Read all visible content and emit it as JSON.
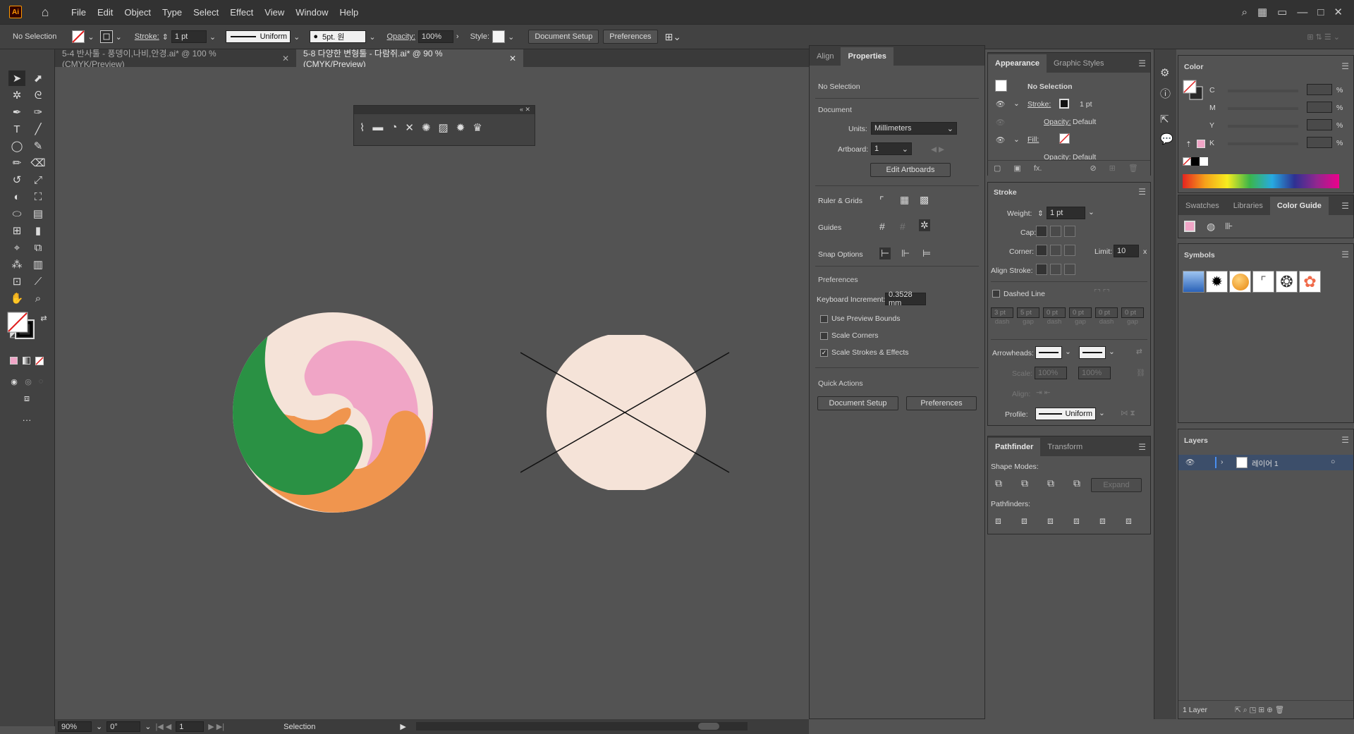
{
  "menubar": {
    "logo": "Ai",
    "menus": [
      "File",
      "Edit",
      "Object",
      "Type",
      "Select",
      "Effect",
      "View",
      "Window",
      "Help"
    ]
  },
  "control": {
    "selection": "No Selection",
    "stroke_label": "Stroke:",
    "stroke_value": "1 pt",
    "stroke_style": "Uniform",
    "brush": "5pt. 원",
    "opacity_label": "Opacity:",
    "opacity_value": "100%",
    "style_label": "Style:",
    "doc_setup": "Document Setup",
    "preferences": "Preferences"
  },
  "tabs": [
    {
      "label": "5-4 반사툴 - 풍뎅이,나비,안경.ai* @ 100 % (CMYK/Preview)",
      "active": false
    },
    {
      "label": "5-8 다양한 변형툴 - 다람쥐.ai* @ 90 % (CMYK/Preview)",
      "active": true
    }
  ],
  "status": {
    "zoom": "90%",
    "rotation": "0°",
    "artboard": "1",
    "tool": "Selection"
  },
  "properties": {
    "tabs": [
      "Align",
      "Properties"
    ],
    "no_selection": "No Selection",
    "document": "Document",
    "units_label": "Units:",
    "units_value": "Millimeters",
    "artboard_label": "Artboard:",
    "artboard_value": "1",
    "edit_artboards": "Edit Artboards",
    "ruler_grids": "Ruler & Grids",
    "guides": "Guides",
    "snap_options": "Snap Options",
    "preferences": "Preferences",
    "keyboard_increment_label": "Keyboard Increment:",
    "keyboard_increment_value": "0.3528 mm",
    "use_preview_bounds": "Use Preview Bounds",
    "scale_corners": "Scale Corners",
    "scale_strokes": "Scale Strokes & Effects",
    "quick_actions": "Quick Actions",
    "doc_setup_btn": "Document Setup",
    "pref_btn": "Preferences"
  },
  "appearance": {
    "tabs": [
      "Appearance",
      "Graphic Styles"
    ],
    "no_selection": "No Selection",
    "stroke_label": "Stroke:",
    "stroke_value": "1 pt",
    "opacity1": "Opacity:",
    "opacity1_value": "Default",
    "fill_label": "Fill:",
    "opacity2": "Opacity:",
    "opacity2_value": "Default"
  },
  "stroke": {
    "title": "Stroke",
    "weight_label": "Weight:",
    "weight_value": "1 pt",
    "cap_label": "Cap:",
    "corner_label": "Corner:",
    "limit_label": "Limit:",
    "limit_value": "10",
    "limit_unit": "x",
    "align_label": "Align Stroke:",
    "dashed": "Dashed Line",
    "dash_vals": [
      "3 pt",
      "5 pt",
      "0 pt",
      "0 pt",
      "0 pt",
      "0 pt"
    ],
    "dash_labels": [
      "dash",
      "gap",
      "dash",
      "gap",
      "dash",
      "gap"
    ],
    "arrowheads": "Arrowheads:",
    "scale_label": "Scale:",
    "scale1": "100%",
    "scale2": "100%",
    "align2_label": "Align:",
    "profile_label": "Profile:",
    "profile_value": "Uniform"
  },
  "pathfinder": {
    "tabs": [
      "Pathfinder",
      "Transform"
    ],
    "shape_modes": "Shape Modes:",
    "expand": "Expand",
    "pathfinders": "Pathfinders:"
  },
  "color": {
    "title": "Color",
    "channels": [
      "C",
      "M",
      "Y",
      "K"
    ],
    "pct": "%",
    "swatch_tabs": [
      "Swatches",
      "Libraries",
      "Color Guide"
    ],
    "symbols": "Symbols",
    "accent_pink": "#f2a0c0"
  },
  "layers": {
    "title": "Layers",
    "layer_name": "레이어 1",
    "count": "1 Layer"
  },
  "artwork": {
    "cream": "#f5e3d8",
    "pink": "#f0a5c6",
    "green": "#2a9144",
    "orange": "#f0954e"
  }
}
